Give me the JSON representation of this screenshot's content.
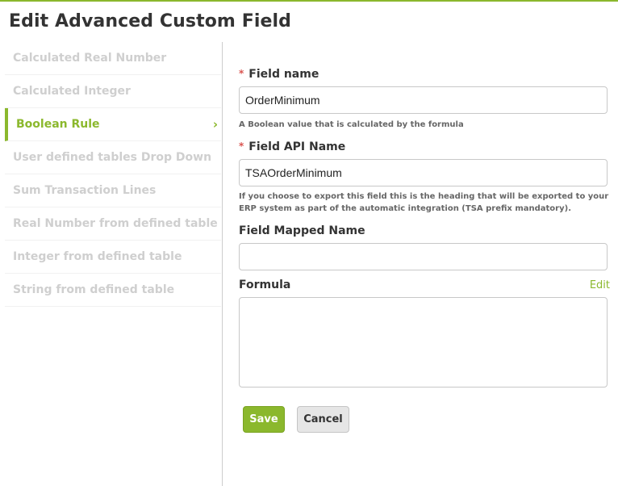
{
  "page": {
    "title": "Edit Advanced Custom Field",
    "accent_color": "#8bb82d"
  },
  "sidebar": {
    "items": [
      {
        "label": "Calculated Real Number",
        "active": false
      },
      {
        "label": "Calculated Integer",
        "active": false
      },
      {
        "label": "Boolean Rule",
        "active": true
      },
      {
        "label": "User defined tables Drop Down",
        "active": false
      },
      {
        "label": "Sum Transaction Lines",
        "active": false
      },
      {
        "label": "Real Number from defined table",
        "active": false
      },
      {
        "label": "Integer from defined table",
        "active": false
      },
      {
        "label": "String from defined table",
        "active": false
      }
    ],
    "active_chevron": "›"
  },
  "form": {
    "required_marker": "*",
    "field_name": {
      "label": "Field name",
      "value": "OrderMinimum",
      "help": "A Boolean value that is calculated by the formula"
    },
    "field_api_name": {
      "label": "Field API Name",
      "value": "TSAOrderMinimum",
      "help": "If you choose to export this field this is the heading that will be exported to your ERP system as part of the automatic integration (TSA prefix mandatory)."
    },
    "field_mapped_name": {
      "label": "Field Mapped Name",
      "value": ""
    },
    "formula": {
      "label": "Formula",
      "edit_label": "Edit",
      "value": ""
    },
    "save_label": "Save",
    "cancel_label": "Cancel"
  }
}
